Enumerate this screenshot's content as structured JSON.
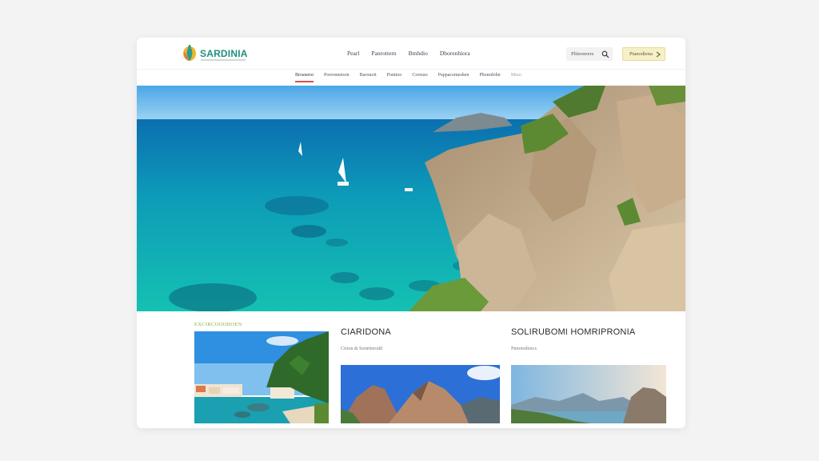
{
  "header": {
    "logo_text": "SARDINIA",
    "nav": [
      "Pearl",
      "Panrottern",
      "Bmhdio",
      "Dborenhiora"
    ],
    "search": {
      "placeholder": "Pltieonrers"
    },
    "cta_label": "Ptanodiena",
    "icons": {
      "logo": "sardinia-logo-icon",
      "search": "search-icon",
      "cta": "arrow-icon"
    }
  },
  "subnav": [
    {
      "label": "Brosnerst",
      "active": true
    },
    {
      "label": "Porronnetorn",
      "active": false
    },
    {
      "label": "Barouoit",
      "active": false
    },
    {
      "label": "Ponttoo",
      "active": false
    },
    {
      "label": "Coreuss",
      "active": false
    },
    {
      "label": "Pappacomeshen",
      "active": false
    },
    {
      "label": "Pbonrdobn",
      "active": false
    },
    {
      "label": "Mtuo",
      "active": false
    }
  ],
  "content": {
    "section_label": "EXCIRCOOOBOEN",
    "cards": [
      {
        "title": "",
        "subtitle": ""
      },
      {
        "title": "CIARIDONA",
        "subtitle": "Crtion & Sortrtterodd"
      },
      {
        "title": "SOLIRUBOMI HOMRIPRONIA",
        "subtitle": "Ptmotodtorcs"
      }
    ]
  },
  "colors": {
    "accent": "#d9534f",
    "brand": "#1e8e7e",
    "section_label": "#8ab33a",
    "cta_bg": "#f6f0c6"
  }
}
